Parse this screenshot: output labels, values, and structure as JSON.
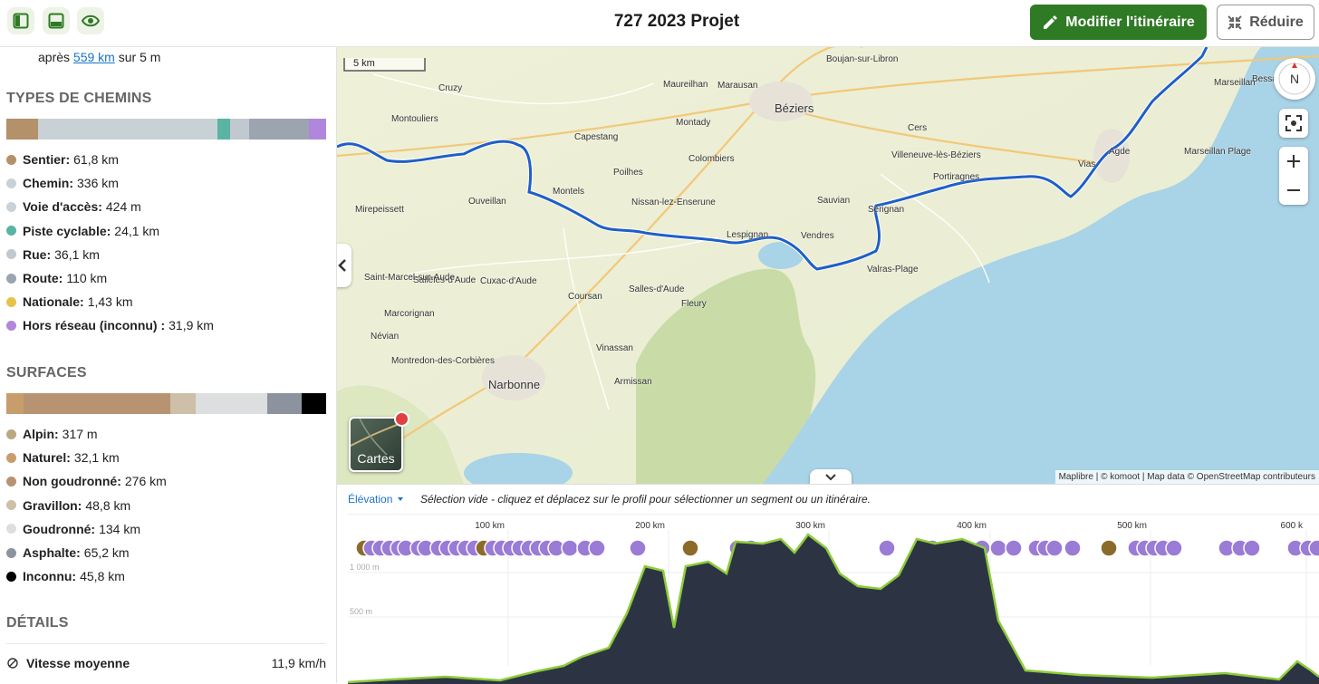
{
  "header": {
    "title": "727 2023 Projet",
    "edit_label": "Modifier l'itinéraire",
    "reduce_label": "Réduire"
  },
  "sidebar": {
    "top_prefix": "après",
    "top_link": "559 km",
    "top_suffix": "sur 5 m",
    "way_types_title": "TYPES DE CHEMINS",
    "way_types": [
      {
        "label": "Sentier:",
        "value": "61,8 km",
        "color": "#b4916a",
        "share": 0.1
      },
      {
        "label": "Chemin:",
        "value": "336 km",
        "color": "#c8d2d6",
        "share": 0.56
      },
      {
        "label": "Voie d'accès:",
        "value": "424 m",
        "color": "#c9d3d7",
        "share": 0.0
      },
      {
        "label": "Piste cyclable:",
        "value": "24,1 km",
        "color": "#5ab3a3",
        "share": 0.04
      },
      {
        "label": "Rue:",
        "value": "36,1 km",
        "color": "#c1c8cf",
        "share": 0.06
      },
      {
        "label": "Route:",
        "value": "110 km",
        "color": "#9ca4b0",
        "share": 0.185
      },
      {
        "label": "Nationale:",
        "value": "1,43 km",
        "color": "#e9c24a",
        "share": 0.0
      },
      {
        "label": "Hors réseau (inconnu) :",
        "value": "31,9 km",
        "color": "#b087dc",
        "share": 0.055
      }
    ],
    "surfaces_title": "SURFACES",
    "surfaces": [
      {
        "label": "Alpin:",
        "value": "317 m",
        "color": "#b7a980",
        "share": 0.0
      },
      {
        "label": "Naturel:",
        "value": "32,1 km",
        "color": "#c89d6c",
        "share": 0.054
      },
      {
        "label": "Non goudronné:",
        "value": "276 km",
        "color": "#b89372",
        "share": 0.46
      },
      {
        "label": "Gravillon:",
        "value": "48,8 km",
        "color": "#cdbfa8",
        "share": 0.08
      },
      {
        "label": "Goudronné:",
        "value": "134 km",
        "color": "#dcdedf",
        "share": 0.225
      },
      {
        "label": "Asphalte:",
        "value": "65,2 km",
        "color": "#8c939f",
        "share": 0.108
      },
      {
        "label": "Inconnu:",
        "value": "45,8 km",
        "color": "#000000",
        "share": 0.076
      }
    ],
    "details_title": "DÉTAILS",
    "details": [
      {
        "label": "Vitesse moyenne",
        "value": "11,9 km/h"
      }
    ]
  },
  "map": {
    "scale_label": "5 km",
    "compass_label": "N",
    "layers_label": "Cartes",
    "attribution": "Maplibre | © komoot | Map data © OpenStreetMap contributeurs",
    "places": [
      "Boujan-sur-Libron",
      "Marausan",
      "Cruzy",
      "Maureilhan",
      "Béziers",
      "Bessan",
      "Marseillan",
      "Montouliers",
      "Montady",
      "Capestang",
      "Colombiers",
      "Cers",
      "Villeneuve-lès-Béziers",
      "Portiragnes",
      "Vias",
      "Agde",
      "Marseillan Plage",
      "Poilhes",
      "Nissan-lez-Enserune",
      "Sauvian",
      "Sérignan",
      "Ouveillan",
      "Mirepeissett",
      "Montels",
      "Lespignan",
      "Vendres",
      "Valras-Plage",
      "Sallèles-d'Aude",
      "Saint-Marcel-sur-Aude",
      "Cuxac-d'Aude",
      "Salles-d'Aude",
      "Coursan",
      "Fleury",
      "Marcorignan",
      "Névian",
      "Vinassan",
      "Montredon-des-Corbières",
      "Narbonne",
      "Armissan"
    ]
  },
  "elevation": {
    "tab_label": "Élévation",
    "hint": "Sélection vide - cliquez et déplacez sur le profil pour sélectionner un segment ou un itinéraire.",
    "distance_ticks": [
      "100 km",
      "200 km",
      "300 km",
      "400 km",
      "500 km",
      "600 k"
    ],
    "elevation_ticks": [
      "1 000 m",
      "500 m"
    ]
  }
}
